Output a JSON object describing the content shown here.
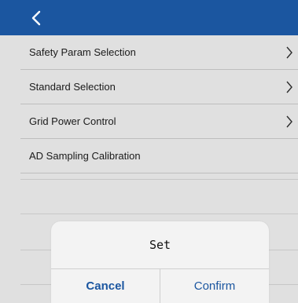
{
  "navbar": {
    "back_icon": "chevron-left-icon",
    "background_color": "#1b56a0"
  },
  "menu": {
    "items": [
      {
        "label": "Safety Param Selection",
        "has_chevron": true
      },
      {
        "label": "Standard Selection",
        "has_chevron": true
      },
      {
        "label": "Grid Power Control",
        "has_chevron": true
      },
      {
        "label": "AD Sampling Calibration",
        "has_chevron": false
      }
    ]
  },
  "dialog": {
    "title": "Set",
    "cancel_label": "Cancel",
    "confirm_label": "Confirm",
    "accent_color": "#1b56a0"
  }
}
